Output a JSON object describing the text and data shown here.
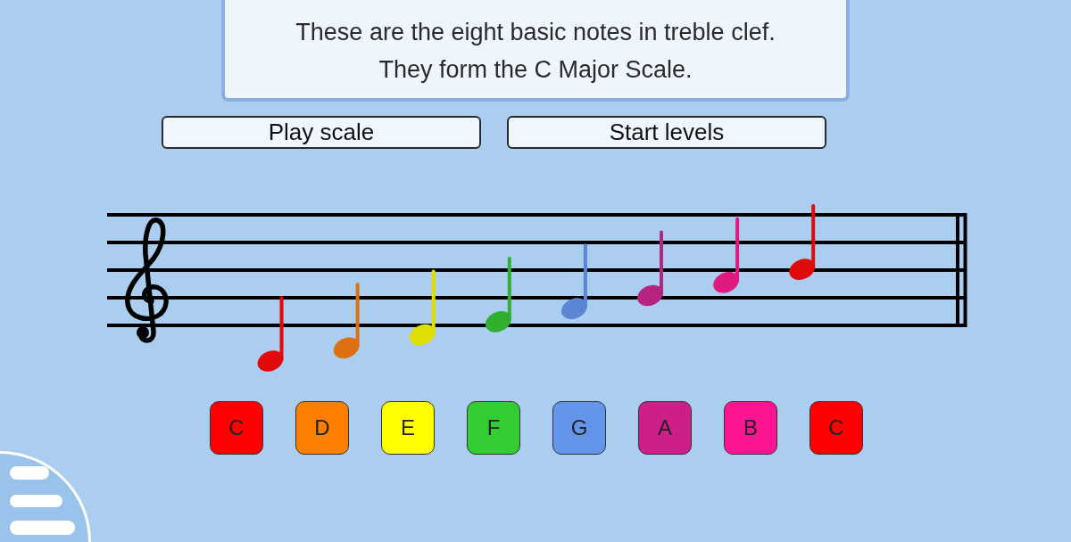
{
  "info_box": {
    "lines": [
      "These are the eight basic notes in treble clef.",
      "They form the C Major Scale."
    ]
  },
  "actions": [
    {
      "label": "Play scale"
    },
    {
      "label": "Start levels"
    }
  ],
  "staff": {
    "notes": [
      {
        "color": "#e00a0a"
      },
      {
        "color": "#dd7010"
      },
      {
        "color": "#dede00"
      },
      {
        "color": "#2fb02f"
      },
      {
        "color": "#5a86d4"
      },
      {
        "color": "#b5257f"
      },
      {
        "color": "#e0197f"
      },
      {
        "color": "#e00a0a"
      }
    ]
  },
  "note_buttons": [
    {
      "label": "C",
      "color": "#ff0000"
    },
    {
      "label": "D",
      "color": "#ff7f00"
    },
    {
      "label": "E",
      "color": "#ffff00"
    },
    {
      "label": "F",
      "color": "#33cc33"
    },
    {
      "label": "G",
      "color": "#6495ed"
    },
    {
      "label": "A",
      "color": "#cc1f8a"
    },
    {
      "label": "B",
      "color": "#ff1493"
    },
    {
      "label": "C",
      "color": "#ff0000"
    }
  ]
}
